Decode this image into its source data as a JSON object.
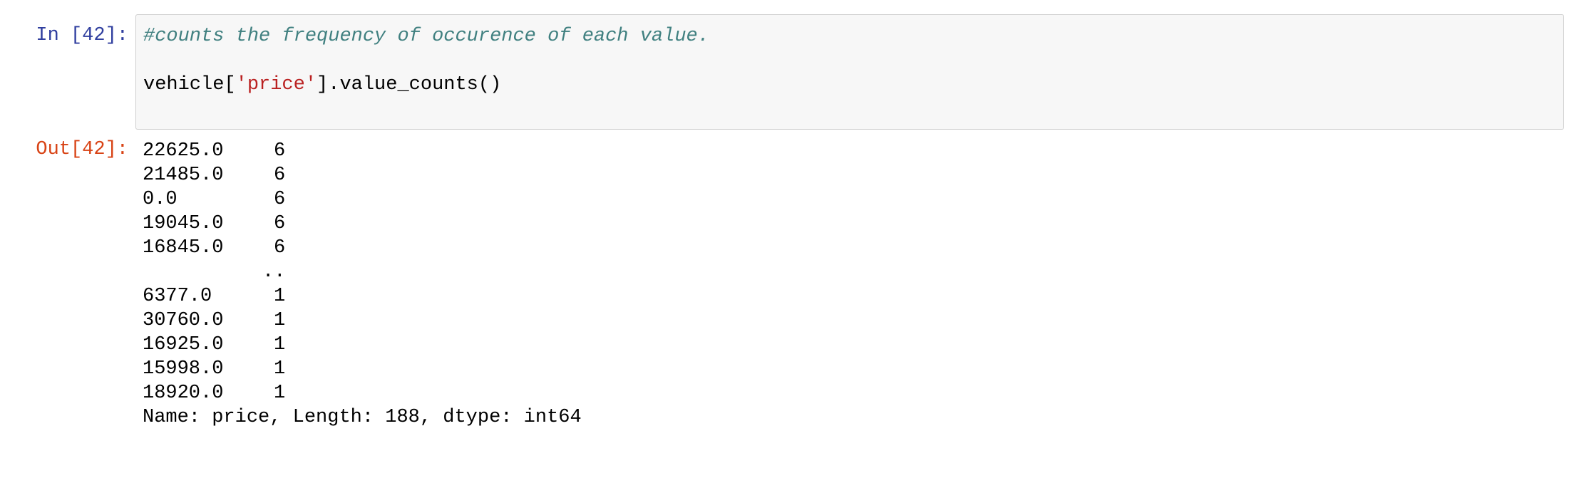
{
  "input_cell": {
    "prompt": "In [42]:",
    "comment": "#counts the frequency of occurence of each value.",
    "code": {
      "prefix": "vehicle[",
      "string": "'price'",
      "suffix": "].value_counts()"
    }
  },
  "output_cell": {
    "prompt": "Out[42]:",
    "rows_head": [
      {
        "key": "22625.0",
        "count": "6"
      },
      {
        "key": "21485.0",
        "count": "6"
      },
      {
        "key": "0.0",
        "count": "6"
      },
      {
        "key": "19045.0",
        "count": "6"
      },
      {
        "key": "16845.0",
        "count": "6"
      }
    ],
    "ellipsis": "..",
    "rows_tail": [
      {
        "key": "6377.0",
        "count": "1"
      },
      {
        "key": "30760.0",
        "count": "1"
      },
      {
        "key": "16925.0",
        "count": "1"
      },
      {
        "key": "15998.0",
        "count": "1"
      },
      {
        "key": "18920.0",
        "count": "1"
      }
    ],
    "footer": "Name: price, Length: 188, dtype: int64"
  },
  "colors": {
    "in_prompt": "#303f9f",
    "out_prompt": "#d84315",
    "comment": "#408080",
    "string": "#ba2121",
    "input_bg": "#f7f7f7",
    "input_border": "#cfcfcf"
  }
}
